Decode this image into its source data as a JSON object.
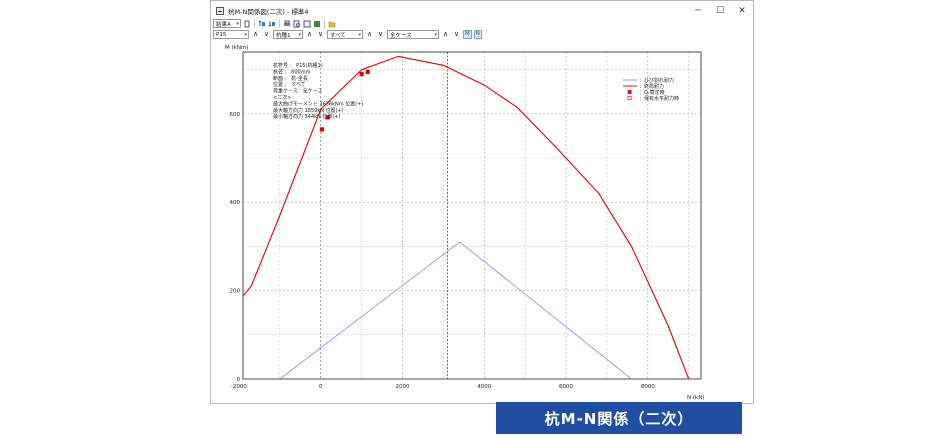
{
  "window": {
    "title": "杭M-N関係図(二次) - 標準4",
    "minimize_glyph": "─",
    "maximize_glyph": "☐",
    "close_glyph": "✕"
  },
  "toolbar1": {
    "case_select": "結果A",
    "icons": [
      "copy-icon",
      "sort-icon",
      "sort-desc-icon",
      "print-icon",
      "preview-icon",
      "export-icon",
      "excel-icon",
      "folder-icon"
    ]
  },
  "toolbar2": {
    "pile_select": "P15",
    "group_select": "杭種1",
    "filter_select": "すべて",
    "loadcase_select": "全ケース",
    "mn_button_1": "M",
    "mn_button_2": "N"
  },
  "caption": "杭M-N関係（二次）",
  "chart_data": {
    "type": "line",
    "ylabel": "M (kNm)",
    "xlabel": "N (kN)",
    "xlim": [
      -1900,
      9300
    ],
    "ylim": [
      0,
      740
    ],
    "xticks": [
      -2000,
      0,
      2000,
      4000,
      6000,
      8000
    ],
    "xtick_labels": [
      "-2000",
      "0",
      "2000",
      "4000",
      "6000",
      "8000"
    ],
    "yticks": [
      0,
      200,
      400,
      600
    ],
    "ytick_labels": [
      "0",
      "200",
      "400",
      "600"
    ],
    "grid": true,
    "legend_position": "top-right",
    "info_lines": [
      "杭符号 ： P15(杭種1)",
      "杭径 ： 800mm",
      "断面 ： 杭-全長",
      "位置 ： すべて",
      "荷重ケース：全ケース",
      "<二次>",
      "最大曲げモーメント 3636kNm 位置(+)",
      "最大軸方向力 1859kN 位置(+)",
      "最小軸方向力 544kN 位置(+)"
    ],
    "series": [
      {
        "name": "ひび割れ耐力",
        "color": "#8a8af0",
        "x": [
          -1000,
          3400,
          7600
        ],
        "y": [
          0,
          310,
          0
        ]
      },
      {
        "name": "終局耐力",
        "color": "#e00000",
        "x": [
          -3600,
          -1700,
          -1000,
          0,
          1000,
          1900,
          3000,
          4000,
          4800,
          5800,
          6800,
          7600,
          8500,
          9000
        ],
        "y": [
          0,
          210,
          370,
          610,
          700,
          730,
          710,
          665,
          615,
          520,
          420,
          300,
          120,
          0
        ]
      }
    ],
    "points": [
      {
        "name": "Q:算定時",
        "color": "#e00000",
        "shape": "filled-square",
        "x": [
          30,
          170,
          1000,
          1150
        ],
        "y": [
          565,
          592,
          690,
          695
        ]
      },
      {
        "name": "保有水平耐力時",
        "color": "#e00000",
        "shape": "open-square",
        "x": [],
        "y": []
      }
    ]
  }
}
